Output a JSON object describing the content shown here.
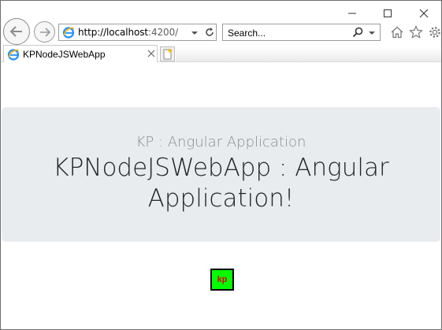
{
  "browser": {
    "address": {
      "host_part": "http://localhost",
      "rest_part": ":4200/"
    },
    "search": {
      "placeholder": "Search..."
    },
    "tab": {
      "title": "KPNodeJSWebApp"
    }
  },
  "page": {
    "subtitle": "KP : Angular Application",
    "headline": "KPNodeJSWebApp : Angular Application!",
    "badge": "kp"
  },
  "colors": {
    "jumbotron_bg": "#e9ecef",
    "badge_bg": "#00ff00",
    "badge_text": "#e00000"
  }
}
